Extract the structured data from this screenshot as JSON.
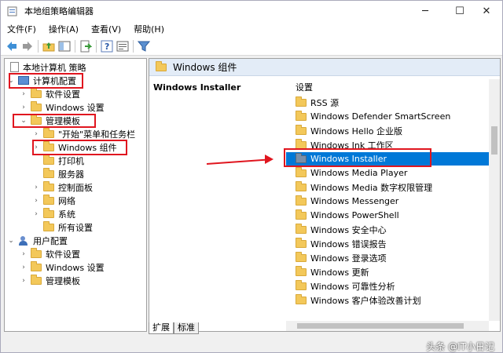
{
  "window": {
    "title": "本地组策略编辑器",
    "minimize": "─",
    "maximize": "☐",
    "close": "✕"
  },
  "menu": {
    "items": [
      "文件(F)",
      "操作(A)",
      "查看(V)",
      "帮助(H)"
    ]
  },
  "toolbar": {
    "icons": [
      "back-arrow-icon",
      "forward-arrow-icon",
      "up-folder-icon",
      "show-hide-tree-icon",
      "export-list-icon",
      "help-icon",
      "properties-icon",
      "filter-icon"
    ]
  },
  "tree": {
    "root": "本地计算机 策略",
    "computer_config": "计算机配置",
    "software_settings": "软件设置",
    "windows_settings": "Windows 设置",
    "admin_templates": "管理模板",
    "start_menu": "\"开始\"菜单和任务栏",
    "windows_components": "Windows 组件",
    "printers": "打印机",
    "server": "服务器",
    "control_panel": "控制面板",
    "network": "网络",
    "system": "系统",
    "all_settings": "所有设置",
    "user_config": "用户配置",
    "user_software": "软件设置",
    "user_windows": "Windows 设置",
    "user_admin": "管理模板"
  },
  "right": {
    "header": "Windows 组件",
    "description_title": "Windows Installer",
    "column_header": "设置",
    "items": [
      "RSS 源",
      "Windows Defender SmartScreen",
      "Windows Hello 企业版",
      "Windows Ink 工作区",
      "Windows Installer",
      "Windows Media Player",
      "Windows Media 数字权限管理",
      "Windows Messenger",
      "Windows PowerShell",
      "Windows 安全中心",
      "Windows 错误报告",
      "Windows 登录选项",
      "Windows 更新",
      "Windows 可靠性分析",
      "Windows 客户体验改善计划"
    ],
    "selected_index": 4
  },
  "tabs": {
    "extended": "扩展",
    "standard": "标准"
  },
  "watermark": "头条 @IT小日记",
  "colors": {
    "selection": "#0078d7",
    "annotation": "#e0161f",
    "folder": "#f3c85a",
    "header_bg": "#e3ecf7"
  }
}
